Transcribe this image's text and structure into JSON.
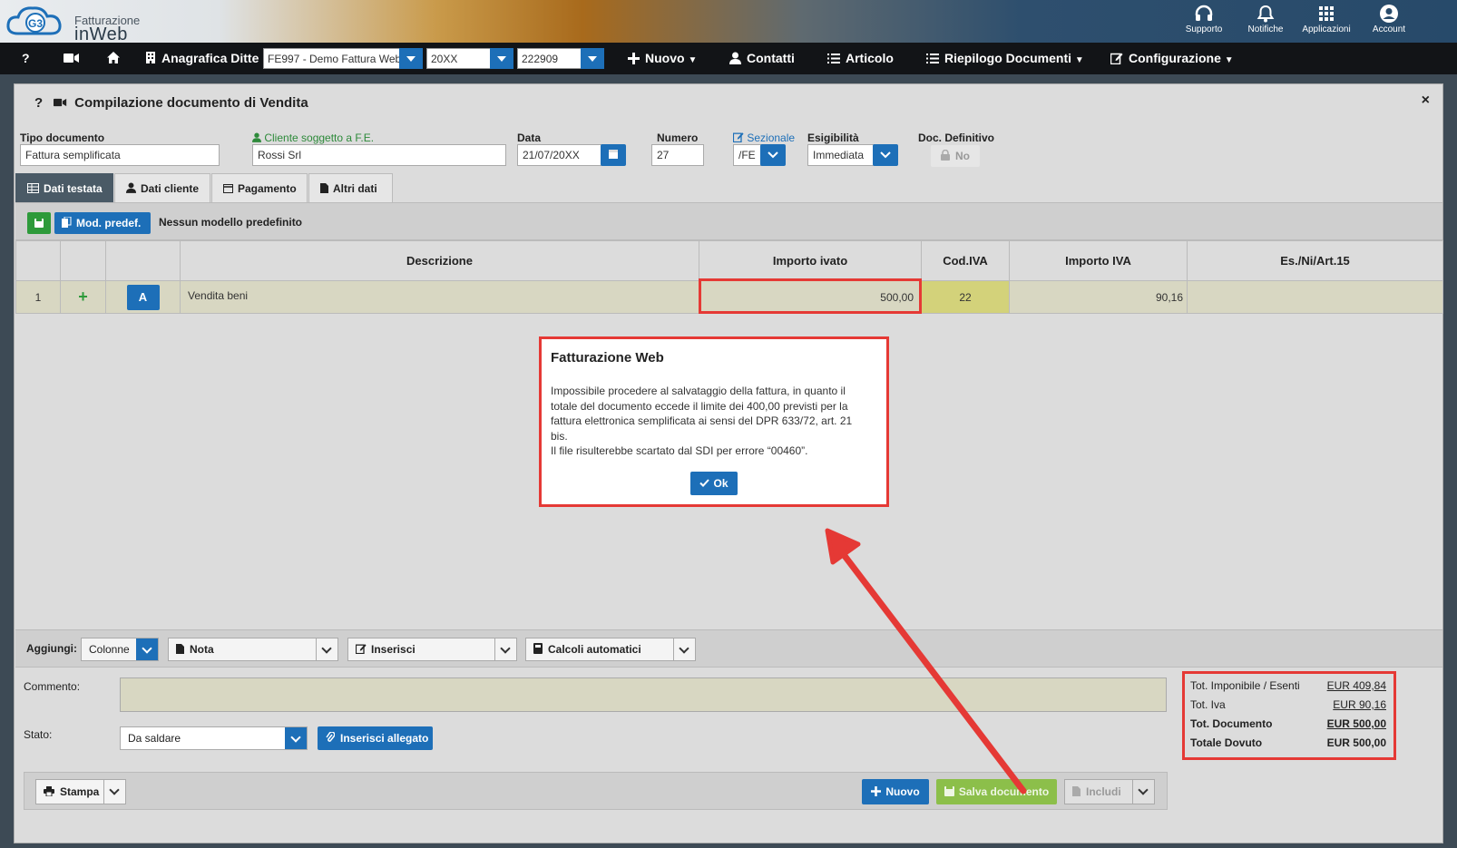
{
  "header": {
    "logo_line1": "Fatturazione",
    "logo_line2": "inWeb",
    "logo_badge": "G3",
    "icons": [
      {
        "icon": "headset-icon",
        "label": "Supporto"
      },
      {
        "icon": "bell-icon",
        "label": "Notifiche"
      },
      {
        "icon": "grid-icon",
        "label": "Applicazioni"
      },
      {
        "icon": "user-circle-icon",
        "label": "Account"
      }
    ]
  },
  "nav": {
    "help": "?",
    "anagrafica": "Anagrafica Ditte",
    "ditta_value": "FE997 - Demo Fattura Web",
    "anno_value": "20XX",
    "codice_value": "222909",
    "nuovo": "Nuovo",
    "contatti": "Contatti",
    "articolo": "Articolo",
    "riepilogo": "Riepilogo Documenti",
    "configurazione": "Configurazione"
  },
  "panel": {
    "help": "?",
    "title": "Compilazione documento di Vendita",
    "close": "×",
    "fields": {
      "tipo_label": "Tipo documento",
      "tipo_value": "Fattura semplificata",
      "cliente_label": "Cliente soggetto a F.E.",
      "cliente_value": "Rossi Srl",
      "data_label": "Data",
      "data_value": "21/07/20XX",
      "numero_label": "Numero",
      "numero_value": "27",
      "sezionale_label": "Sezionale",
      "sezionale_value": "/FE",
      "esigibilita_label": "Esigibilità",
      "esigibilita_value": "Immediata",
      "definitivo_label": "Doc. Definitivo",
      "definitivo_value": "No"
    },
    "tabs": [
      "Dati testata",
      "Dati cliente",
      "Pagamento",
      "Altri dati"
    ],
    "mod_predef": "Mod. predef.",
    "mod_text": "Nessun modello predefinito"
  },
  "grid": {
    "headers": [
      "",
      "",
      "",
      "Descrizione",
      "Importo ivato",
      "Cod.IVA",
      "Importo IVA",
      "Es./Ni/Art.15"
    ],
    "row": {
      "num": "1",
      "plus": "+",
      "a": "A",
      "descrizione": "Vendita beni",
      "importo_ivato": "500,00",
      "cod_iva": "22",
      "importo_iva": "90,16",
      "esenzione": ""
    }
  },
  "modal": {
    "title": "Fatturazione Web",
    "body_1": "Impossibile procedere al salvataggio della fattura, in quanto il totale del documento eccede il limite dei 400,00 previsti per la fattura elettronica semplificata ai sensi del DPR 633/72, art. 21 bis.",
    "body_2": "Il file risulterebbe scartato dal SDI per errore “00460”.",
    "ok": "Ok"
  },
  "bottom": {
    "aggiungi": "Aggiungi:",
    "colonne": "Colonne",
    "nota": "Nota",
    "inserisci": "Inserisci",
    "calcoli": "Calcoli automatici",
    "commento_label": "Commento:",
    "stato_label": "Stato:",
    "stato_value": "Da saldare",
    "allegato": "Inserisci allegato",
    "stampa": "Stampa",
    "nuovo": "Nuovo",
    "salva": "Salva documento",
    "includi": "Includi"
  },
  "totals": [
    {
      "label": "Tot. Imponibile / Esenti",
      "value": "EUR 409,84"
    },
    {
      "label": "Tot. Iva",
      "value": "EUR 90,16"
    },
    {
      "label": "Tot. Documento",
      "value": "EUR 500,00"
    },
    {
      "label": "Totale Dovuto",
      "value": "EUR 500,00"
    }
  ],
  "colors": {
    "accent_blue": "#1d6fb8",
    "green": "#2d9a3a",
    "highlight_red": "#e53935",
    "row_bg": "#d8d7c2"
  }
}
